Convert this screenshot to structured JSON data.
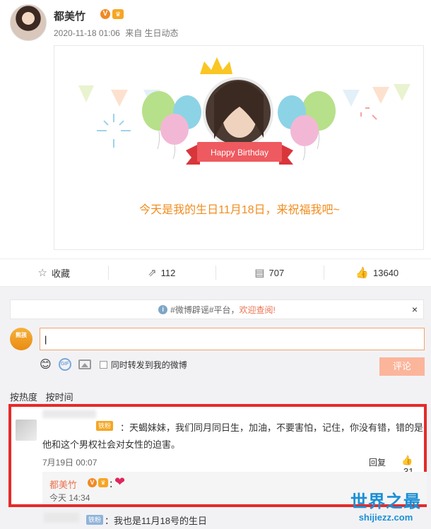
{
  "post": {
    "author": "都美竹",
    "verified_badge": "V",
    "timestamp": "2020-11-18 01:06",
    "source": "来自 生日动态",
    "card": {
      "banner": "Happy Birthday",
      "text": "今天是我的生日11月18日，来祝福我吧~"
    }
  },
  "actions": {
    "favorite_label": "收藏",
    "repost_count": "112",
    "comment_count": "707",
    "like_count": "13640"
  },
  "notice": {
    "prefix": "#微博辟谣#平台，",
    "link": "欢迎查阅!",
    "close": "×"
  },
  "composer": {
    "input_value": "|",
    "repost_label": "同时转发到我的微博",
    "submit_label": "评论",
    "my_avatar_text": "熊孩"
  },
  "sort": {
    "hot": "按热度",
    "time": "按时间"
  },
  "comment": {
    "badge": "铁粉",
    "text": "：天蝎妹妹，我们同月同日生，加油，不要害怕，记住，你没有错，错的是他和这个男权社会对女性的迫害。",
    "time": "7月19日 00:07",
    "reply_label": "回复",
    "like_count": "31",
    "reply": {
      "author": "都美竹",
      "colon": "：",
      "heart": "❤",
      "time": "今天 14:34"
    }
  },
  "next_comment": {
    "badge": "铁粉",
    "text": "：我也是11月18号的生日"
  },
  "watermark": {
    "line1": "世界之最",
    "line2": "shijiezz.com"
  },
  "colors": {
    "accent": "#eb7350",
    "highlight_border": "#e52a2a",
    "birthday_text": "#f28c1e"
  }
}
